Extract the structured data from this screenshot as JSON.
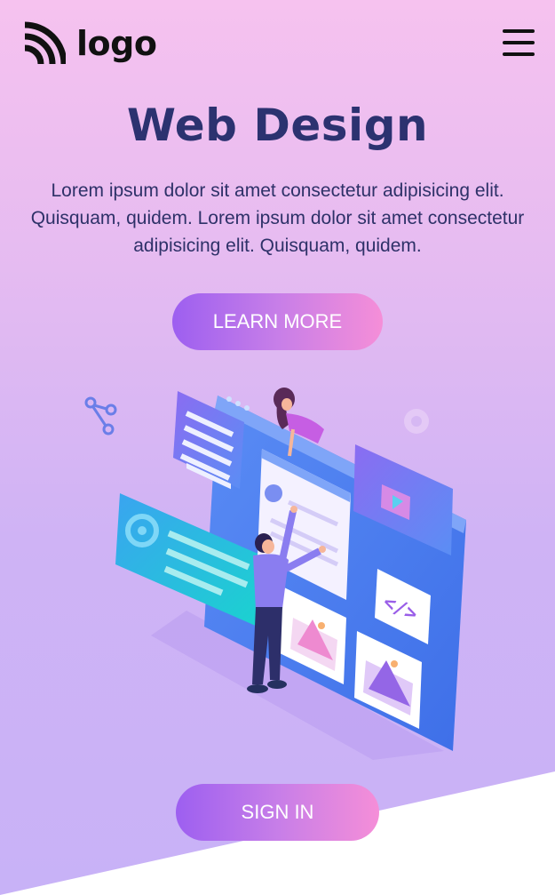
{
  "header": {
    "logo_text": "logo",
    "logo_icon": "rss-feed-icon",
    "menu_icon": "hamburger-menu-icon"
  },
  "hero": {
    "title": "Web Design",
    "description": "Lorem ipsum dolor sit amet consectetur adipisicing elit. Quisquam, quidem. Lorem ipsum dolor sit amet consectetur adipisicing elit. Quisquam, quidem.",
    "learn_more_label": "LEARN MORE",
    "illustration": "isometric-web-design-illustration"
  },
  "footer": {
    "sign_in_label": "SIGN IN"
  },
  "colors": {
    "title": "#2c3270",
    "button_gradient_start": "#9d5ff0",
    "button_gradient_end": "#f58ed8",
    "background_top": "#f6c2ef",
    "background_bottom": "#c8b2f7"
  }
}
